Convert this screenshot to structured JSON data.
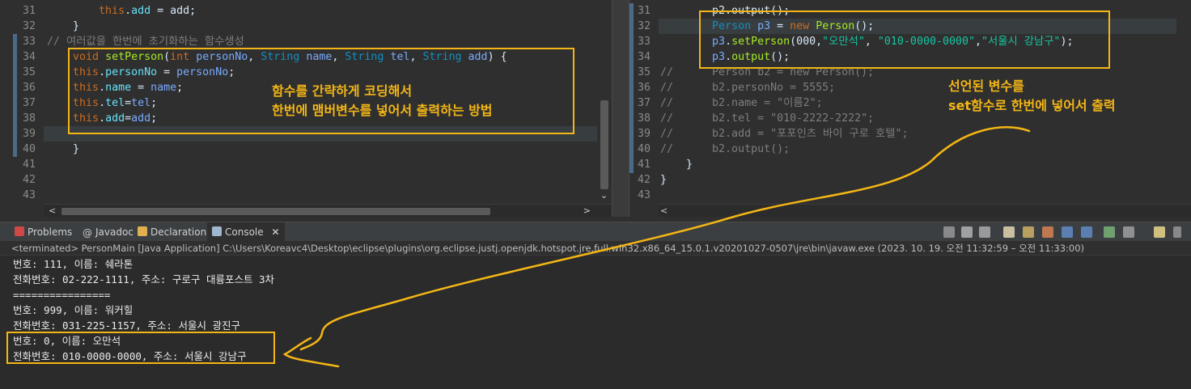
{
  "left_editor": {
    "lines": [
      {
        "n": "31",
        "html": "        <span class='kw'>this</span>.<span class='fld'>add</span> = add;"
      },
      {
        "n": "32",
        "html": "    }"
      },
      {
        "n": "33",
        "html": "<span class='cm'>// 여러값을 한번에 초기화하는 함수생성</span>"
      },
      {
        "n": "34",
        "html": "    <span class='kw'>void</span> <span class='mt'>setPerson</span>(<span class='kw'>int</span> <span class='lv'>personNo</span>, <span class='ty'>String</span> <span class='lv'>name</span>, <span class='ty'>String</span> <span class='lv'>tel</span>, <span class='ty'>String</span> <span class='lv'>add</span>) {"
      },
      {
        "n": "35",
        "html": "    <span class='kw'>this</span>.<span class='fld'>personNo</span> = <span class='lv'>personNo</span>;"
      },
      {
        "n": "36",
        "html": "    <span class='kw'>this</span>.<span class='fld'>name</span> = <span class='lv'>name</span>;"
      },
      {
        "n": "37",
        "html": "    <span class='kw'>this</span>.<span class='fld'>tel</span>=<span class='lv'>tel</span>;"
      },
      {
        "n": "38",
        "html": "    <span class='kw'>this</span>.<span class='fld'>add</span>=<span class='lv'>add</span>;"
      },
      {
        "n": "39",
        "html": ""
      },
      {
        "n": "40",
        "html": "    }"
      },
      {
        "n": "41",
        "html": ""
      },
      {
        "n": "42",
        "html": ""
      },
      {
        "n": "43",
        "html": ""
      }
    ],
    "annotation_line1": "함수를 간략하게 코딩해서",
    "annotation_line2": "한번에 맴버변수를 넣어서 출력하는 방법"
  },
  "right_editor": {
    "lines": [
      {
        "n": "31",
        "html": "        p2.output();"
      },
      {
        "n": "32",
        "html": "        <span class='ty'>Person</span> <span class='lv'>p3</span> = <span class='kw'>new</span> <span class='mt'>Person</span>();"
      },
      {
        "n": "33",
        "html": "        <span class='lv'>p3</span>.<span class='mt'>setPerson</span>(000,<span class='str'>\"오만석\"</span>, <span class='str'>\"010-0000-0000\"</span>,<span class='str'>\"서울시 강남구\"</span>);"
      },
      {
        "n": "34",
        "html": "        <span class='lv'>p3</span>.<span class='mt'>output</span>();"
      },
      {
        "n": "35",
        "html": "<span class='cm'>//      Person b2 = new Person();</span>"
      },
      {
        "n": "36",
        "html": "<span class='cm'>//      b2.personNo = 5555;</span>"
      },
      {
        "n": "37",
        "html": "<span class='cm'>//      b2.name = \"이름2\";</span>"
      },
      {
        "n": "38",
        "html": "<span class='cm'>//      b2.tel = \"010-2222-2222\";</span>"
      },
      {
        "n": "39",
        "html": "<span class='cm'>//      b2.add = \"포포인츠 바이 구로 호텔\";</span>"
      },
      {
        "n": "40",
        "html": "<span class='cm'>//      b2.output();</span>"
      },
      {
        "n": "41",
        "html": "    }"
      },
      {
        "n": "42",
        "html": "}"
      },
      {
        "n": "43",
        "html": ""
      }
    ],
    "annotation_line1": "선언된 변수를",
    "annotation_line2": "set함수로 한번에 넣어서 출력"
  },
  "console": {
    "tabs": [
      {
        "label": "Problems",
        "color": "#d04848"
      },
      {
        "label": "Javadoc",
        "color": "#c9c9c9"
      },
      {
        "label": "Declaration",
        "color": "#e0b050"
      },
      {
        "label": "Console",
        "color": "#9fb7d0",
        "active": true,
        "close": "✕"
      }
    ],
    "status": "<terminated> PersonMain [Java Application] C:\\Users\\Koreavc4\\Desktop\\eclipse\\plugins\\org.eclipse.justj.openjdk.hotspot.jre.full.win32.x86_64_15.0.1.v20201027-0507\\jre\\bin\\javaw.exe  (2023. 10. 19. 오전 11:32:59 – 오전 11:33:00)",
    "output": [
      "번호: 111, 이름: 쉐라톤",
      "전화번호: 02-222-1111, 주소: 구로구 대륭포스트 3차",
      "================",
      "번호: 999, 이름: 워커힐",
      "전화번호: 031-225-1157, 주소: 서울시 광진구",
      "번호: 0, 이름: 오만석",
      "전화번호: 010-0000-0000, 주소: 서울시 강남구"
    ]
  },
  "colors": {
    "annotation": "#f3b615",
    "editor_bg": "#2f2f2f",
    "console_bg": "#2b2b2b"
  }
}
